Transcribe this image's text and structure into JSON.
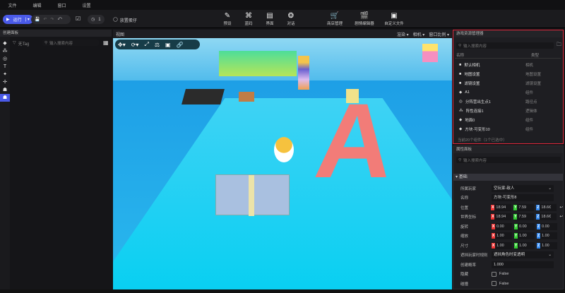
{
  "menu": [
    "文件",
    "编辑",
    "窗口",
    "设置"
  ],
  "toolbar": {
    "run": "运行",
    "counter": "1",
    "place": "放置蛋仔",
    "tools": [
      {
        "icon": "preset-icon",
        "g": "✎",
        "label": "预设"
      },
      {
        "icon": "code-icon",
        "g": "⌘",
        "label": "蓝码"
      },
      {
        "icon": "ui-icon",
        "g": "▤",
        "label": "界面"
      },
      {
        "icon": "dialog-icon",
        "g": "❂",
        "label": "对话"
      },
      {
        "icon": "shop-icon",
        "g": "🛒",
        "label": "商店管理"
      },
      {
        "icon": "clip-icon",
        "g": "🎬",
        "label": "剧情编辑器"
      },
      {
        "icon": "file-icon",
        "g": "▣",
        "label": "自定义文件"
      }
    ]
  },
  "create_panel": {
    "title": "创建面板",
    "tag": "无Tag",
    "search_placeholder": "输入搜索内容"
  },
  "viewport": {
    "title": "视图",
    "options": [
      "渲染 ▾",
      "相机 ▾",
      "窗口比例 ▾"
    ],
    "letter": "A"
  },
  "explorer": {
    "title": "游戏资源管理器",
    "search_placeholder": "输入搜索内容",
    "col_name": "名称",
    "col_type": "类型",
    "items": [
      {
        "name": "默认相机",
        "type": "相机",
        "g": "■"
      },
      {
        "name": "地图设置",
        "type": "地图设置",
        "g": "■"
      },
      {
        "name": "滤镜设置",
        "type": "滤镜设置",
        "g": "■"
      },
      {
        "name": "A1",
        "type": "组件",
        "g": "◆"
      },
      {
        "name": "分阵营出生点1",
        "type": "路径点",
        "g": "◎"
      },
      {
        "name": "阵性连接1",
        "type": "逻辑体",
        "g": "⁂"
      },
      {
        "name": "地面0",
        "type": "组件",
        "g": "◆"
      },
      {
        "name": "方块-可变形10",
        "type": "组件",
        "g": "◆"
      }
    ],
    "footer": "当前20个组件（1个已选中）"
  },
  "properties": {
    "title": "属性面板",
    "search_placeholder": "输入搜索内容",
    "section": "基础",
    "owner_label": "所属玩家",
    "owner": "空玩家-敌人",
    "name_label": "名称",
    "name": "方块-可变形8",
    "vectors": [
      {
        "label": "位置",
        "x": "18.94",
        "y": "7.59",
        "z": "18.6€"
      },
      {
        "label": "世界坐标",
        "x": "18.94",
        "y": "7.59",
        "z": "18.6€"
      },
      {
        "label": "旋转",
        "x": "0.00",
        "y": "0.00",
        "z": "0.00"
      },
      {
        "label": "缩放",
        "x": "1.00",
        "y": "1.00",
        "z": "1.00"
      },
      {
        "label": "尺寸",
        "x": "1.00",
        "y": "1.00",
        "z": "1.00"
      }
    ],
    "occlude_label": "遮挡玩家时规则",
    "occlude": "遮挡角色时变透明",
    "prob_label": "创建概率",
    "prob": "1.000",
    "checks": [
      {
        "label": "隐藏",
        "value": "False"
      },
      {
        "label": "碰撞",
        "value": "False"
      }
    ]
  }
}
